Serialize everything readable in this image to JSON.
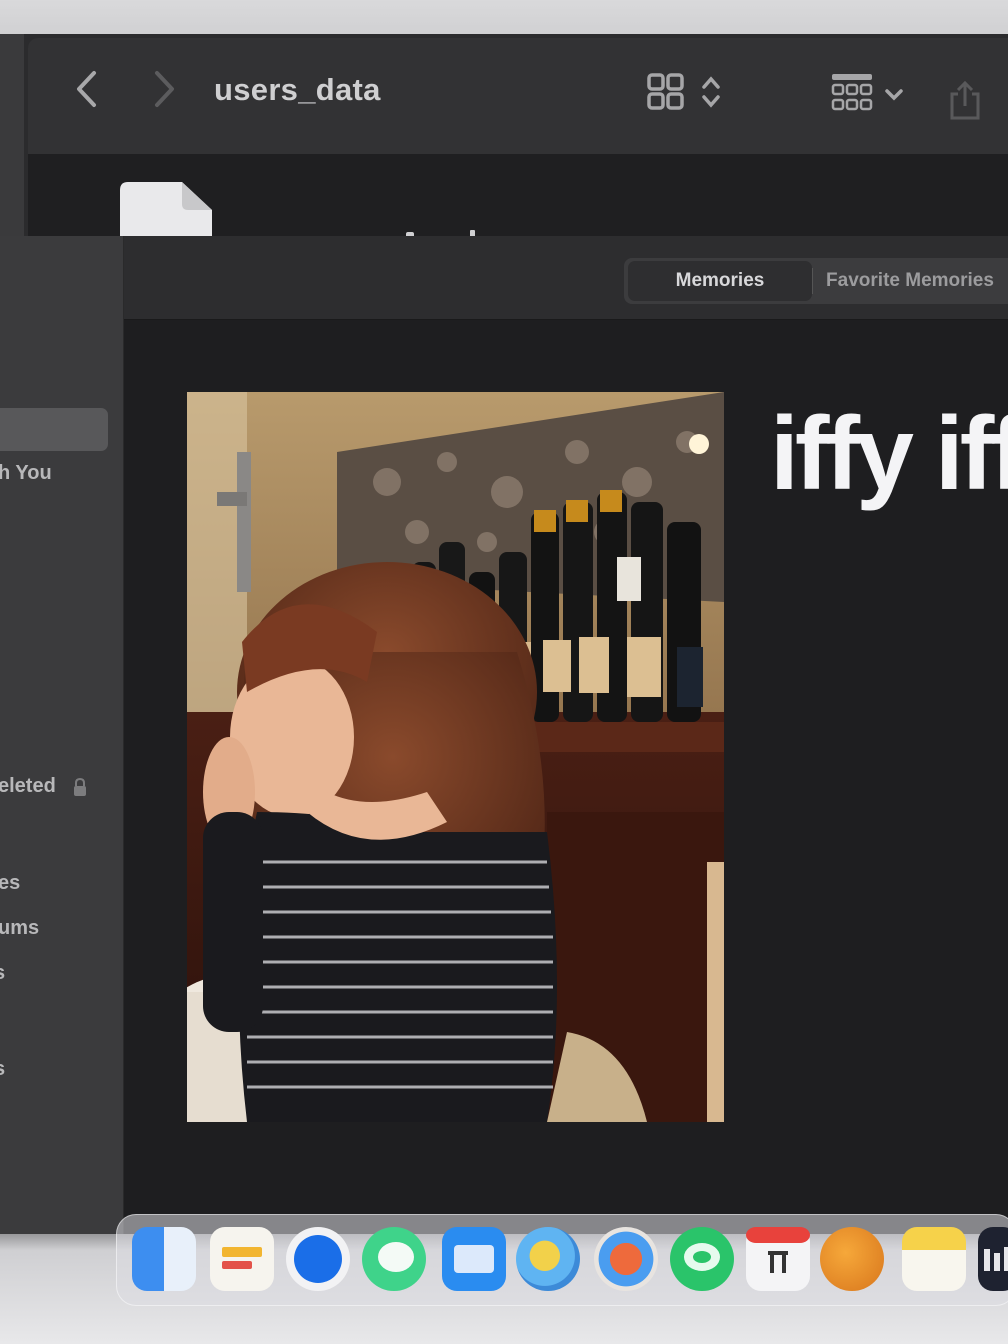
{
  "finder": {
    "title": "users_data",
    "icons": [
      "chevron-left-icon",
      "chevron-right-icon",
      "grid-view-icon",
      "group-by-icon",
      "share-icon"
    ]
  },
  "photos": {
    "segments": [
      "Memories",
      "Favorite Memories"
    ],
    "active_segment": "Memories",
    "sidebar": {
      "visible_items": [
        "h You",
        "eleted",
        "es",
        "ums",
        "s",
        "s"
      ]
    },
    "caption": "iffy iffy"
  },
  "dock": {
    "apps": [
      "finder-icon",
      "notes-app-icon",
      "safari-icon",
      "messages-icon",
      "mail-icon",
      "maps-icon",
      "photos-icon",
      "facetime-icon",
      "calendar-icon",
      "contacts-icon",
      "notes-icon",
      "stocks-icon"
    ]
  },
  "colors": {
    "window_bg": "#1e1e20",
    "sidebar_bg": "#3b3b3d",
    "text_light": "#f4f4f6"
  }
}
